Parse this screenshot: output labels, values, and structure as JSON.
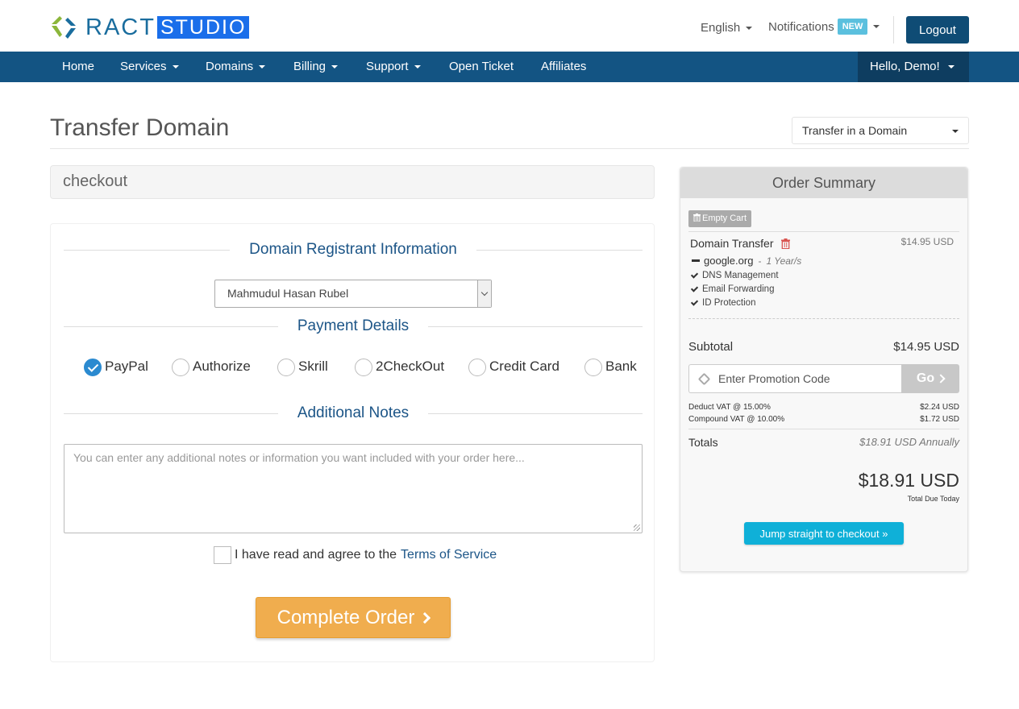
{
  "brand": {
    "part1": "RACT",
    "part2": "STUDIO"
  },
  "header": {
    "language": "English",
    "notifications": "Notifications",
    "notifications_badge": "NEW",
    "logout": "Logout"
  },
  "nav": {
    "items": [
      {
        "label": "Home"
      },
      {
        "label": "Services"
      },
      {
        "label": "Domains"
      },
      {
        "label": "Billing"
      },
      {
        "label": "Support"
      },
      {
        "label": "Open Ticket"
      },
      {
        "label": "Affiliates"
      }
    ],
    "user": "Hello, Demo!"
  },
  "page": {
    "title": "Transfer Domain",
    "action_select": "Transfer in a Domain",
    "breadcrumb": "checkout"
  },
  "form": {
    "registrant_heading": "Domain Registrant Information",
    "registrant_value": "Mahmudul Hasan Rubel",
    "payment_heading": "Payment Details",
    "payment_methods": [
      {
        "label": "PayPal",
        "checked": true
      },
      {
        "label": "Authorize",
        "checked": false
      },
      {
        "label": "Skrill",
        "checked": false
      },
      {
        "label": "2CheckOut",
        "checked": false
      },
      {
        "label": "Credit Card",
        "checked": false
      },
      {
        "label": "Bank",
        "checked": false
      }
    ],
    "notes_heading": "Additional Notes",
    "notes_placeholder": "You can enter any additional notes or information you want included with your order here...",
    "tos_text": "I have read and agree to the",
    "tos_link": "Terms of Service",
    "complete_button": "Complete Order"
  },
  "summary": {
    "heading": "Order Summary",
    "empty_cart": "Empty Cart",
    "item": {
      "name": "Domain Transfer",
      "price": "$14.95 USD",
      "domain": "google.org",
      "period": "1 Year/s",
      "addons": [
        "DNS Management",
        "Email Forwarding",
        "ID Protection"
      ]
    },
    "subtotal_label": "Subtotal",
    "subtotal_value": "$14.95 USD",
    "promo_placeholder": "Enter Promotion Code",
    "promo_button": "Go",
    "taxes": [
      {
        "label": "Deduct VAT @ 15.00%",
        "value": "$2.24 USD"
      },
      {
        "label": "Compound VAT @ 10.00%",
        "value": "$1.72 USD"
      }
    ],
    "totals_label": "Totals",
    "totals_recurring": "$18.91 USD Annually",
    "total_due": "$18.91 USD",
    "total_due_label": "Total Due Today",
    "checkout_button": "Jump straight to checkout »"
  },
  "colors": {
    "nav_bg": "#135483",
    "nav_user_bg": "#0e3d60",
    "logout_bg": "#0f4c75",
    "heading_blue": "#1c5587",
    "complete_btn": "#f0ad4e",
    "checkout_btn": "#0fb0d8",
    "radio_checked": "#2b8ad0",
    "badge_new": "#5bc0de",
    "trash_red": "#d9534f"
  }
}
